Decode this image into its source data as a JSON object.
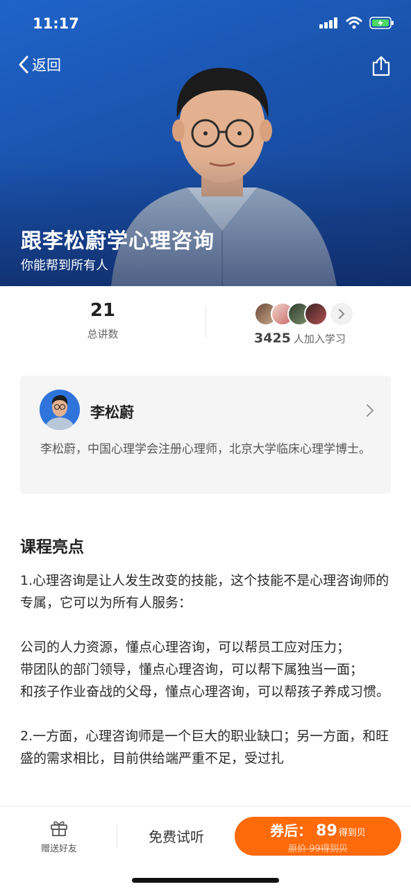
{
  "status_bar": {
    "time": "11:17"
  },
  "nav": {
    "back_label": "返回"
  },
  "hero": {
    "title": "跟李松蔚学心理咨询",
    "subtitle": "你能帮到所有人",
    "background_color": "#1a53ad"
  },
  "stats": {
    "lectures_count": "21",
    "lectures_label": "总讲数",
    "learners_count": "3425",
    "learners_label": "人加入学习"
  },
  "teacher": {
    "name": "李松蔚",
    "bio": "李松蔚，中国心理学会注册心理师，北京大学临床心理学博士。"
  },
  "highlights": {
    "title": "课程亮点",
    "p1": "1.心理咨询是让人发生改变的技能，这个技能不是心理咨询师的专属，它可以为所有人服务：",
    "p2": "公司的人力资源，懂点心理咨询，可以帮员工应对压力；",
    "p3": "带团队的部门领导，懂点心理咨询，可以帮下属独当一面；",
    "p4": "和孩子作业奋战的父母，懂点心理咨询，可以帮孩子养成习惯。",
    "p5": "2.一方面，心理咨询师是一个巨大的职业缺口；另一方面，和旺盛的需求相比，目前供给端严重不足，受过扎"
  },
  "bottom_bar": {
    "gift_label": "赠送好友",
    "trial_label": "免费试听",
    "buy_label": "券后：",
    "buy_price": "89",
    "buy_unit": "得到贝",
    "original_price": "原价 99得到贝",
    "accent_color": "#ff6a0a"
  },
  "icons": [
    "back-chevron-icon",
    "share-icon",
    "signal-icon",
    "wifi-icon",
    "battery-icon",
    "chevron-right-icon",
    "gift-icon"
  ]
}
